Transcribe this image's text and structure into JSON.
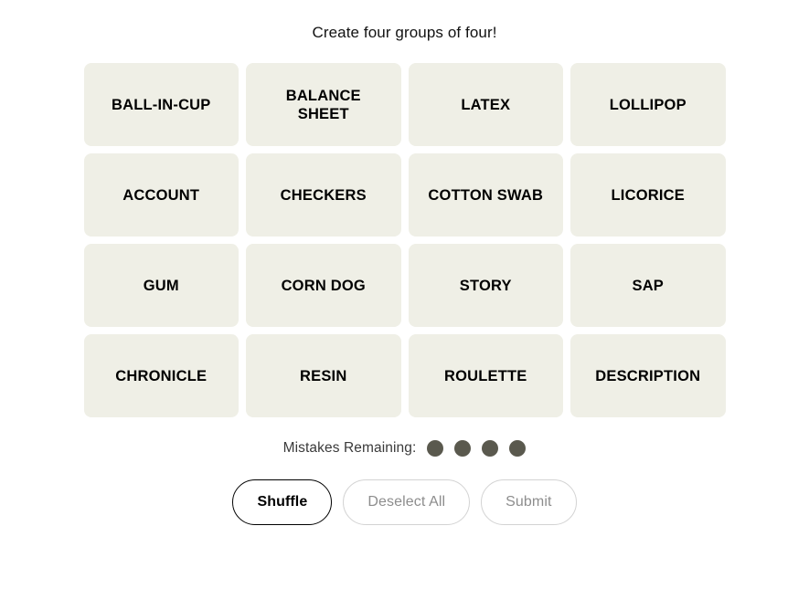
{
  "header": {
    "instruction": "Create four groups of four!"
  },
  "board": {
    "rows": 4,
    "columns": 4,
    "tiles": [
      {
        "label": "BALL-IN-CUP",
        "selected": false
      },
      {
        "label": "BALANCE\nSHEET",
        "selected": false
      },
      {
        "label": "LATEX",
        "selected": false
      },
      {
        "label": "LOLLIPOP",
        "selected": false
      },
      {
        "label": "ACCOUNT",
        "selected": false
      },
      {
        "label": "CHECKERS",
        "selected": false
      },
      {
        "label": "COTTON SWAB",
        "selected": false
      },
      {
        "label": "LICORICE",
        "selected": false
      },
      {
        "label": "GUM",
        "selected": false
      },
      {
        "label": "CORN DOG",
        "selected": false
      },
      {
        "label": "STORY",
        "selected": false
      },
      {
        "label": "SAP",
        "selected": false
      },
      {
        "label": "CHRONICLE",
        "selected": false
      },
      {
        "label": "RESIN",
        "selected": false
      },
      {
        "label": "ROULETTE",
        "selected": false
      },
      {
        "label": "DESCRIPTION",
        "selected": false
      }
    ]
  },
  "mistakes": {
    "label": "Mistakes Remaining:",
    "remaining": 4,
    "dots": [
      {
        "name": "mistake-dot-1"
      },
      {
        "name": "mistake-dot-2"
      },
      {
        "name": "mistake-dot-3"
      },
      {
        "name": "mistake-dot-4"
      }
    ]
  },
  "actions": {
    "shuffle_label": "Shuffle",
    "deselect_label": "Deselect All",
    "submit_label": "Submit",
    "shuffle_enabled": true,
    "deselect_enabled": false,
    "submit_enabled": false
  },
  "colors": {
    "page_background": "#ffffff",
    "tile_background": "#efefe6",
    "tile_text": "#000000",
    "title_text": "#121212",
    "mistake_dot": "#5a594e",
    "button_enabled_border": "#000000",
    "button_disabled_border": "#d3d3d3",
    "button_disabled_text": "#8d8d8d"
  }
}
